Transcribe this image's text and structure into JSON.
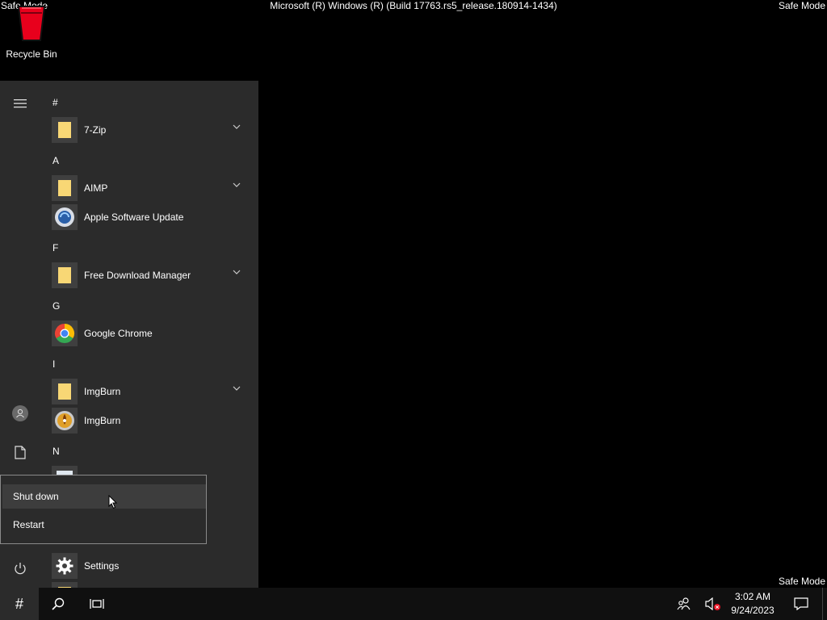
{
  "screen": {
    "safe_mode_label": "Safe Mode",
    "build_info": "Microsoft (R) Windows (R) (Build 17763.rs5_release.180914-1434)"
  },
  "desktop": {
    "icons": [
      {
        "label": "Recycle Bin",
        "icon": "recycle-bin-icon"
      }
    ]
  },
  "start_menu": {
    "rail": {
      "menu_icon": "hamburger-icon",
      "user_icon": "user-icon",
      "documents_icon": "document-icon",
      "power_icon": "power-icon"
    },
    "sections": [
      {
        "header": "#",
        "apps": [
          {
            "name": "7-Zip",
            "icon": "folder-icon",
            "expandable": true
          }
        ]
      },
      {
        "header": "A",
        "apps": [
          {
            "name": "AIMP",
            "icon": "folder-icon",
            "expandable": true
          },
          {
            "name": "Apple Software Update",
            "icon": "apple-update-icon",
            "expandable": false
          }
        ]
      },
      {
        "header": "F",
        "apps": [
          {
            "name": "Free Download Manager",
            "icon": "folder-icon",
            "expandable": true
          }
        ]
      },
      {
        "header": "G",
        "apps": [
          {
            "name": "Google Chrome",
            "icon": "chrome-icon",
            "expandable": false
          }
        ]
      },
      {
        "header": "I",
        "apps": [
          {
            "name": "ImgBurn",
            "icon": "folder-icon",
            "expandable": true
          },
          {
            "name": "ImgBurn",
            "icon": "imgburn-icon",
            "expandable": false
          }
        ]
      },
      {
        "header": "N",
        "apps": []
      },
      {
        "header": "",
        "apps": [
          {
            "name": "Settings",
            "icon": "gear-icon",
            "expandable": false
          }
        ]
      }
    ],
    "power_menu": {
      "items": [
        {
          "label": "Shut down",
          "highlighted": true
        },
        {
          "label": "Restart",
          "highlighted": false
        }
      ]
    }
  },
  "taskbar": {
    "start_glyph": "#",
    "search_icon": "search-icon",
    "task_view_icon": "task-view-icon",
    "people_icon": "people-icon",
    "volume_icon": "volume-muted-icon",
    "clock": {
      "time": "3:02 AM",
      "date": "9/24/2023"
    },
    "notification_icon": "action-center-icon"
  }
}
